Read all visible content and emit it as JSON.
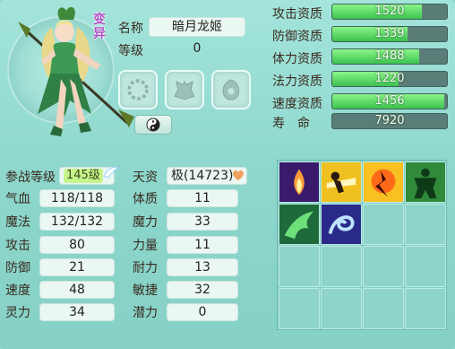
{
  "pet": {
    "name_label": "名称",
    "name": "暗月龙姬",
    "level_label": "等级",
    "level": "0",
    "sect_badge": "变异"
  },
  "battle": {
    "level_label": "参战等级",
    "level_value": "145级",
    "talent_label": "天资",
    "talent_value": "极(14723)"
  },
  "stats_left": [
    {
      "label": "气血",
      "value": "118/118"
    },
    {
      "label": "魔法",
      "value": "132/132"
    },
    {
      "label": "攻击",
      "value": "80"
    },
    {
      "label": "防御",
      "value": "21"
    },
    {
      "label": "速度",
      "value": "48"
    },
    {
      "label": "灵力",
      "value": "34"
    }
  ],
  "stats_right": [
    {
      "label": "体质",
      "value": "11"
    },
    {
      "label": "魔力",
      "value": "33"
    },
    {
      "label": "力量",
      "value": "11"
    },
    {
      "label": "耐力",
      "value": "13"
    },
    {
      "label": "敏捷",
      "value": "32"
    },
    {
      "label": "潜力",
      "value": "0"
    }
  ],
  "aptitudes": [
    {
      "label": "攻击资质",
      "value": "1520",
      "fill": 0.78
    },
    {
      "label": "防御资质",
      "value": "1339",
      "fill": 0.66
    },
    {
      "label": "体力资质",
      "value": "1488",
      "fill": 0.76
    },
    {
      "label": "法力资质",
      "value": "1220",
      "fill": 0.58
    },
    {
      "label": "速度资质",
      "value": "1456",
      "fill": 0.98
    }
  ],
  "life": {
    "label": "寿　命",
    "value": "7920"
  },
  "skills": [
    "flame-pillar-icon",
    "golden-strike-icon",
    "fire-strike-icon",
    "green-strength-icon",
    "green-dragon-icon",
    "blue-whirl-icon"
  ],
  "empty_skill_slots": 10,
  "colors": {
    "panel_bg": "#8fd8cf",
    "aptitude_fill": "#3dc24f",
    "level_highlight": "#c6f58c",
    "badge": "#b150c8"
  }
}
